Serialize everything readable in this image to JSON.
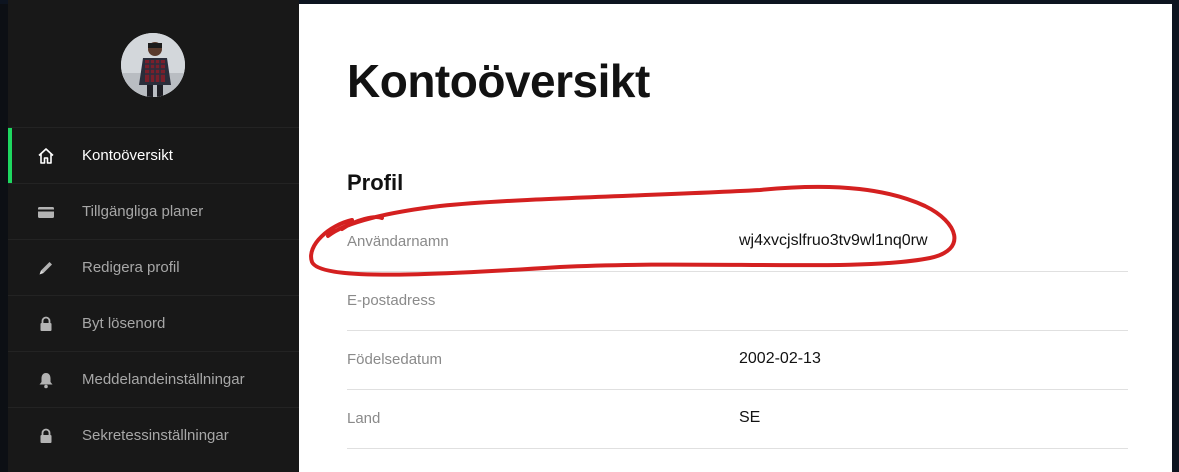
{
  "sidebar": {
    "items": [
      {
        "label": "Kontoöversikt",
        "icon": "home-icon",
        "active": true
      },
      {
        "label": "Tillgängliga planer",
        "icon": "credit-card-icon",
        "active": false
      },
      {
        "label": "Redigera profil",
        "icon": "pencil-icon",
        "active": false
      },
      {
        "label": "Byt lösenord",
        "icon": "lock-icon",
        "active": false
      },
      {
        "label": "Meddelandeinställningar",
        "icon": "bell-icon",
        "active": false
      },
      {
        "label": "Sekretessinställningar",
        "icon": "lock-icon",
        "active": false
      }
    ]
  },
  "main": {
    "title": "Kontoöversikt",
    "section_title": "Profil",
    "rows": [
      {
        "label": "Användarnamn",
        "value": "wj4xvcjslfruo3tv9wl1nq0rw"
      },
      {
        "label": "E-postadress",
        "value": ""
      },
      {
        "label": "Födelsedatum",
        "value": "2002-02-13"
      },
      {
        "label": "Land",
        "value": "SE"
      }
    ]
  },
  "colors": {
    "sidebar_bg": "#181818",
    "active_indicator": "#1ed760",
    "annotation": "#d42020"
  }
}
